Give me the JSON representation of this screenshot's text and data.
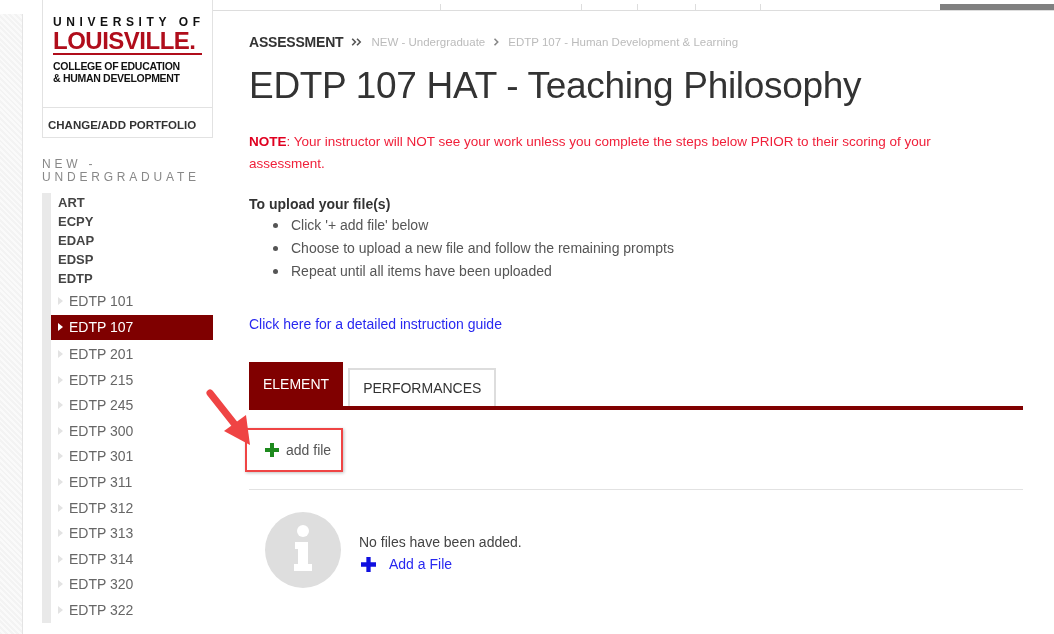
{
  "logo": {
    "line_1": "UNIVERSITY OF",
    "line_2": "LOUISVILLE.",
    "line_3": "COLLEGE OF EDUCATION",
    "line_4": "& HUMAN DEVELOPMENT"
  },
  "portfolio_button": "CHANGE/ADD PORTFOLIO",
  "sidebar": {
    "heading": "NEW - UNDERGRADUATE",
    "items": [
      {
        "label": "ART"
      },
      {
        "label": "ECPY"
      },
      {
        "label": "EDAP"
      },
      {
        "label": "EDSP"
      },
      {
        "label": "EDTP",
        "children": [
          {
            "label": "EDTP 101",
            "selected": false
          },
          {
            "label": "EDTP 107",
            "selected": true
          },
          {
            "label": "EDTP 201",
            "selected": false
          },
          {
            "label": "EDTP 215",
            "selected": false
          },
          {
            "label": "EDTP 245",
            "selected": false
          },
          {
            "label": "EDTP 300",
            "selected": false
          },
          {
            "label": "EDTP 301",
            "selected": false
          },
          {
            "label": "EDTP 311",
            "selected": false
          },
          {
            "label": "EDTP 312",
            "selected": false
          },
          {
            "label": "EDTP 313",
            "selected": false
          },
          {
            "label": "EDTP 314",
            "selected": false
          },
          {
            "label": "EDTP 320",
            "selected": false
          },
          {
            "label": "EDTP 322",
            "selected": false
          }
        ]
      }
    ]
  },
  "breadcrumb": [
    {
      "label": "ASSESSMENT",
      "kind": "root"
    },
    {
      "label": "NEW - Undergraduate",
      "kind": "link"
    },
    {
      "label": "EDTP 107 - Human Development & Learning",
      "kind": "link"
    }
  ],
  "title": "EDTP 107 HAT - Teaching Philosophy",
  "note": "**NOTE**: Your instructor will NOT see your work unless you complete the steps below PRIOR to their scoring of your assessment.",
  "instructions": {
    "heading": "To upload your file(s)",
    "steps": [
      "Click '+ add file' below",
      "Choose to upload a new file and follow the remaining prompts",
      "Repeat until all items have been uploaded"
    ]
  },
  "guide_link": "Click here for a detailed instruction guide",
  "tabs": [
    {
      "label": "ELEMENT",
      "selected": true
    },
    {
      "label": "PERFORMANCES",
      "selected": false
    }
  ],
  "add_file": {
    "label": "add file",
    "highlighted": true
  },
  "empty_state": {
    "message": "No files have been added.",
    "action": "Add a File"
  }
}
